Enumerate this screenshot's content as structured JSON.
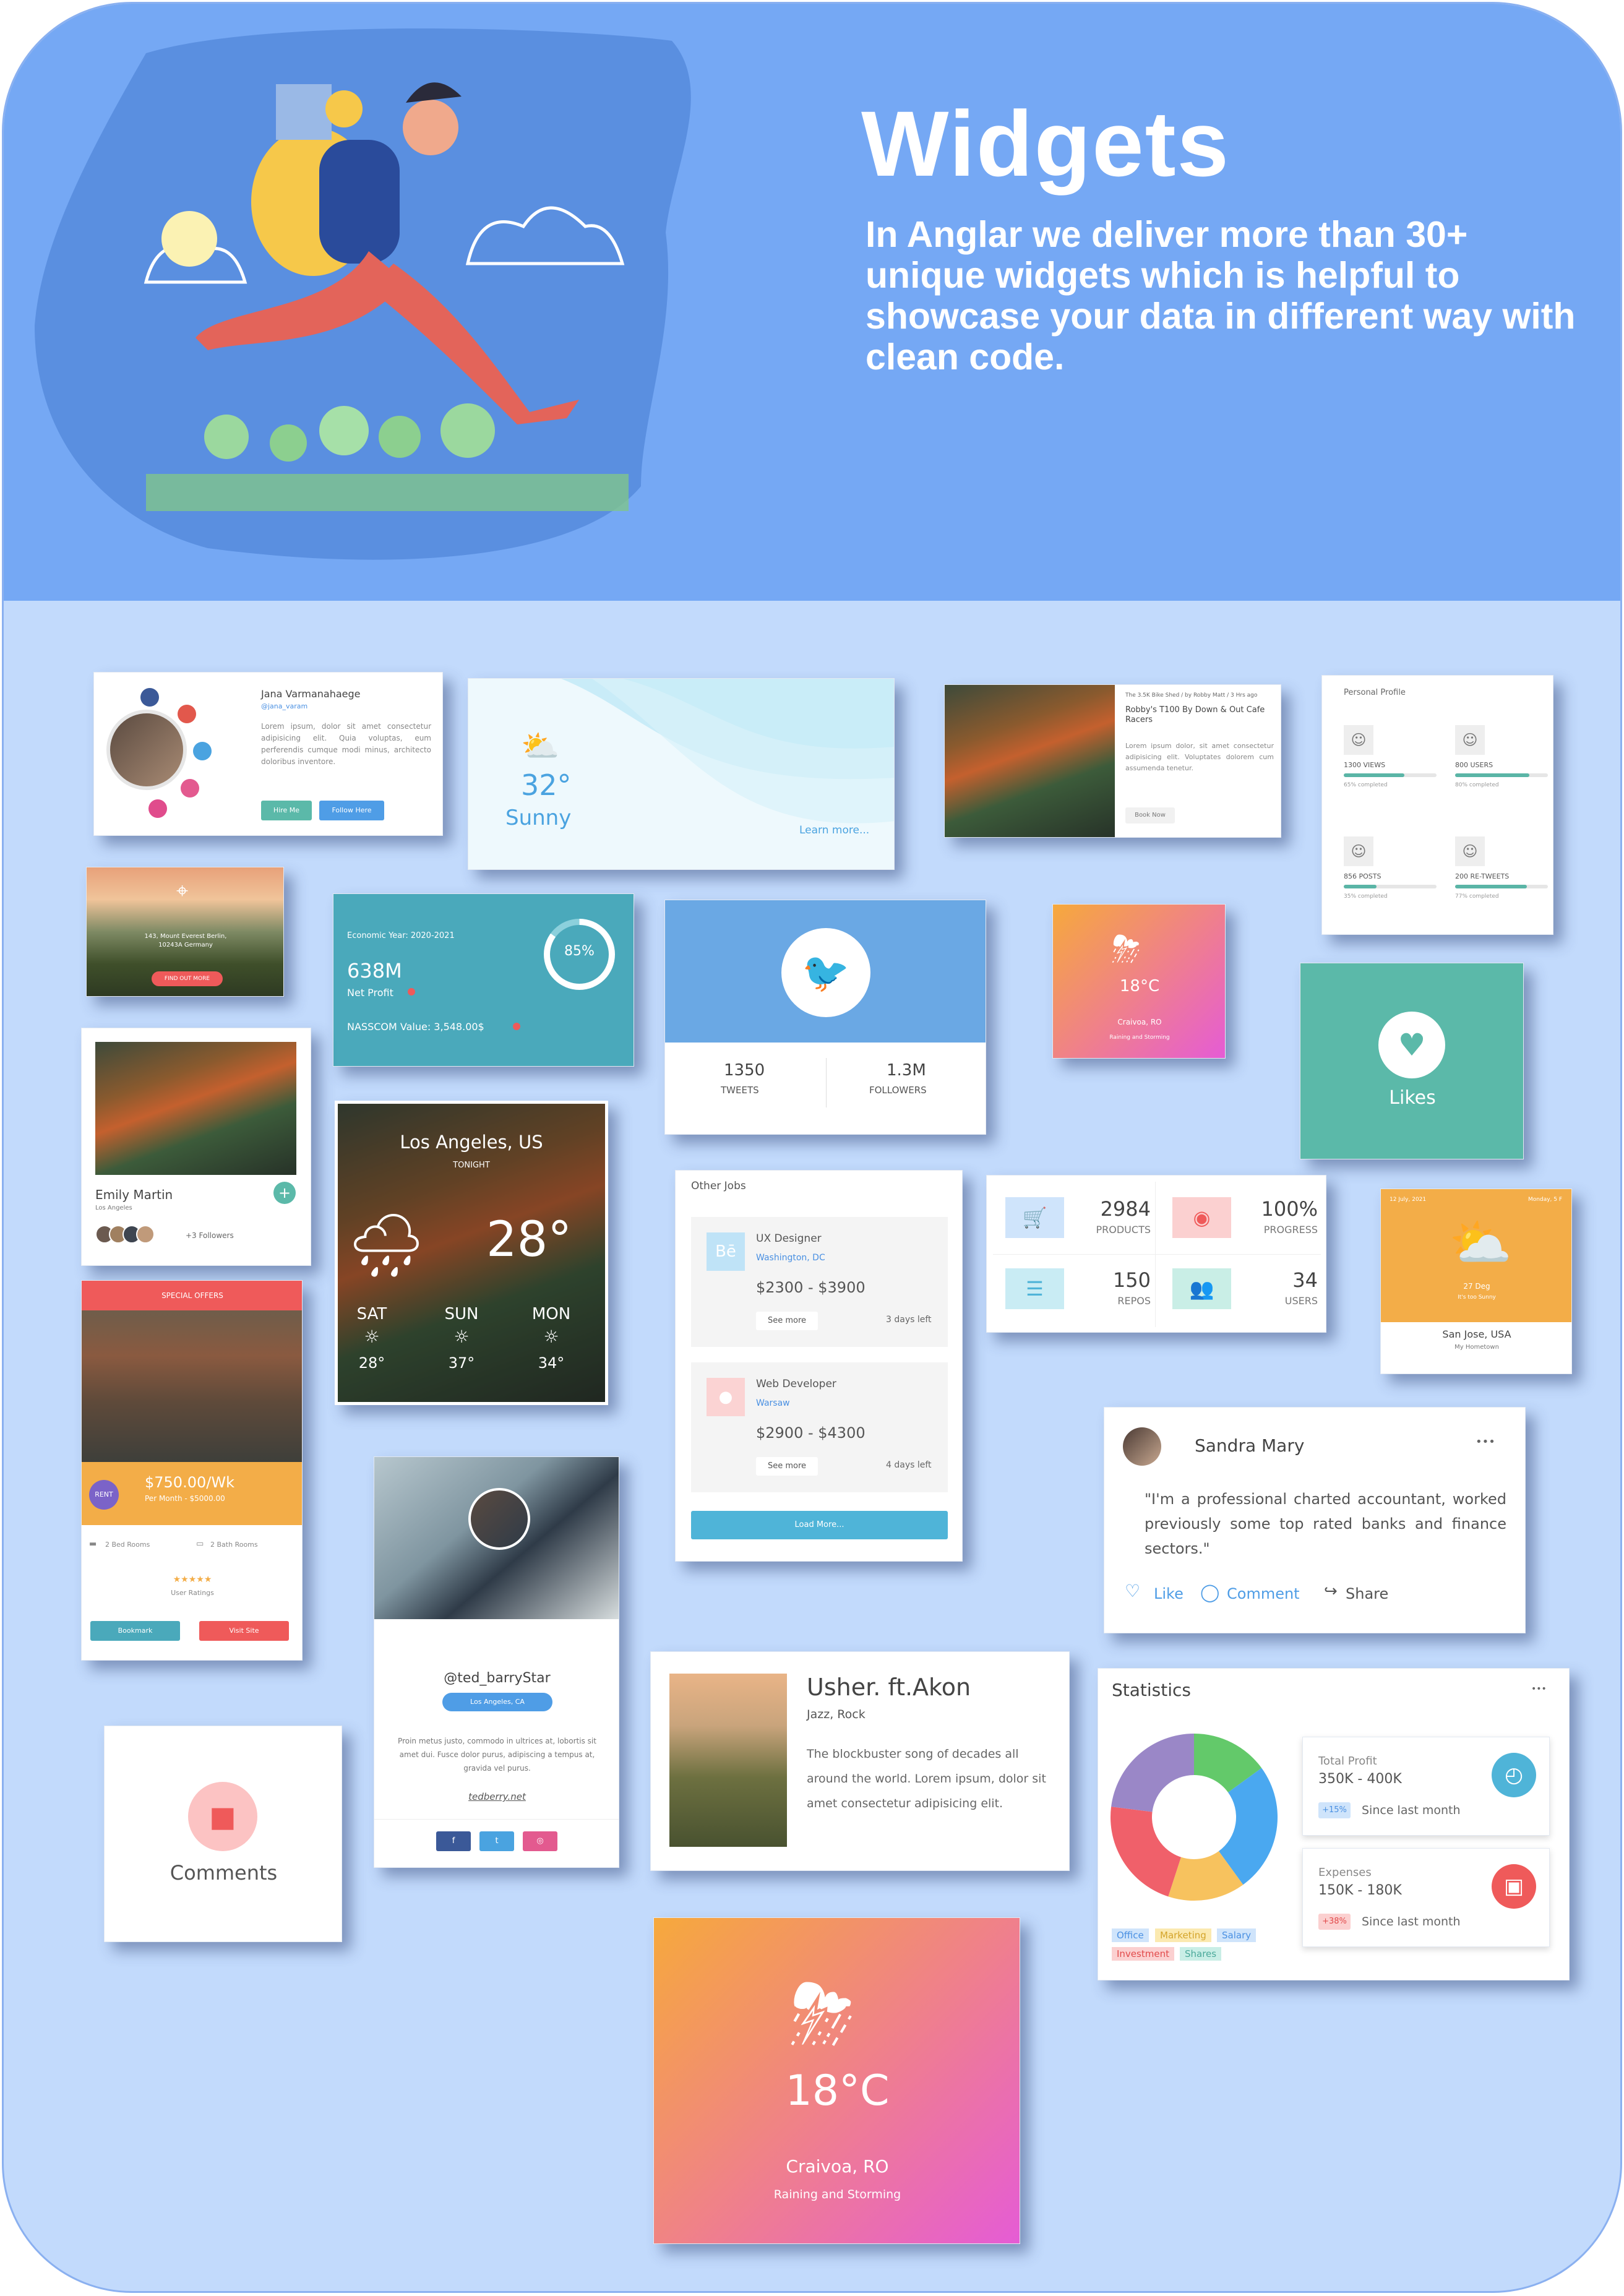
{
  "hero": {
    "title": "Widgets",
    "subtitle": "In Anglar we deliver more than 30+ unique widgets which is helpful to showcase your data in different way with clean code."
  },
  "profile": {
    "name": "Jana Varmanahaege",
    "handle": "@jana_varam",
    "bio": "Lorem ipsum, dolor sit amet consectetur adipisicing elit. Quia voluptas, eum perferendis cumque modi minus, architecto doloribus inventore.",
    "hire": "Hire Me",
    "follow": "Follow Here"
  },
  "weather_sunny": {
    "temp": "32°",
    "cond": "Sunny",
    "link": "Learn more..."
  },
  "blog": {
    "meta": "The 3.5K Bike Shed / by Robby Matt / 3 Hrs ago",
    "title": "Robby's T100 By Down & Out Cafe Racers",
    "body": "Lorem ipsum dolor, sit amet consectetur adipisicing elit. Voluptates dolorem cum assumenda tenetur.",
    "button": "Book Now"
  },
  "personal": {
    "title": "Personal Profile",
    "stats": [
      {
        "label": "1300 VIEWS",
        "sub": "65% completed",
        "pct": 0.65
      },
      {
        "label": "800 USERS",
        "sub": "80% completed",
        "pct": 0.8
      },
      {
        "label": "856 POSTS",
        "sub": "35% completed",
        "pct": 0.35
      },
      {
        "label": "200 RE-TWEETS",
        "sub": "77% completed",
        "pct": 0.77
      }
    ]
  },
  "location": {
    "address": "143, Mount Everest Berlin, 10243A Germany",
    "button": "FIND OUT MORE"
  },
  "economy": {
    "year": "Economic Year: 2020-2021",
    "value": "638M",
    "label": "Net Profit",
    "pct": "85%",
    "nasscom": "NASSCOM Value: 3,548.00$"
  },
  "twitter": {
    "tweets": "1350",
    "tweets_label": "TWEETS",
    "followers": "1.3M",
    "followers_label": "FOLLOWERS"
  },
  "weather_small": {
    "temp": "18°C",
    "city": "Craivoa, RO",
    "cond": "Raining and Storming"
  },
  "likes": {
    "label": "Likes"
  },
  "emily": {
    "name": "Emily Martin",
    "city": "Los Angeles",
    "followers": "+3 Followers"
  },
  "la": {
    "city": "Los Angeles, US",
    "tonight": "TONIGHT",
    "temp": "28°",
    "days": [
      {
        "d": "SAT",
        "t": "28°"
      },
      {
        "d": "SUN",
        "t": "37°"
      },
      {
        "d": "MON",
        "t": "34°"
      }
    ]
  },
  "jobs": {
    "title": "Other Jobs",
    "items": [
      {
        "logo": "Bē",
        "role": "UX Designer",
        "city": "Washington, DC",
        "range": "$2300 - $3900",
        "more": "See more",
        "left": "3 days left"
      },
      {
        "logo": "●",
        "role": "Web Developer",
        "city": "Warsaw",
        "range": "$2900 - $4300",
        "more": "See more",
        "left": "4 days left"
      }
    ],
    "load": "Load More..."
  },
  "stats4": [
    {
      "v": "2984",
      "l": "PRODUCTS"
    },
    {
      "v": "100%",
      "l": "PROGRESS"
    },
    {
      "v": "150",
      "l": "REPOS"
    },
    {
      "v": "34",
      "l": "USERS"
    }
  ],
  "sanjose": {
    "date": "12 July, 2021",
    "day": "Monday, 5 F",
    "temp": "27 Deg",
    "sub": "It's too Sunny",
    "city": "San Jose, USA",
    "home": "My Hometown"
  },
  "offer": {
    "header": "SPECIAL OFFERS",
    "badge": "RENT",
    "price": "$750.00/Wk",
    "sub": "Per Month - $5000.00",
    "bed": "2 Bed Rooms",
    "bath": "2 Bath Rooms",
    "stars": "★★★★★",
    "rating": "User Ratings",
    "bookmark": "Bookmark",
    "visit": "Visit Site"
  },
  "ted": {
    "handle": "@ted_barryStar",
    "city": "Los Angeles, CA",
    "bio": "Proin metus justo, commodo in ultrices at, lobortis sit amet dui. Fusce dolor purus, adipiscing a tempus at, gravida vel purus.",
    "site": "tedberry.net",
    "f": "f",
    "tw": "t",
    "ig": "◎"
  },
  "sandra": {
    "name": "Sandra Mary",
    "dots": "•••",
    "quote": "\"I'm a professional charted accountant, worked previously some top rated banks and finance sectors.\"",
    "like": "Like",
    "comment": "Comment",
    "share": "Share"
  },
  "usher": {
    "title": "Usher. ft.Akon",
    "genre": "Jazz, Rock",
    "body": "The blockbuster song of decades all around the world. Lorem ipsum, dolor sit amet consectetur adipisicing elit."
  },
  "comments": {
    "label": "Comments"
  },
  "statistics": {
    "title": "Statistics",
    "dots": "•••",
    "profit": {
      "label": "Total Profit",
      "range": "350K - 400K",
      "badge": "+15%",
      "since": "Since last month"
    },
    "expenses": {
      "label": "Expenses",
      "range": "150K - 180K",
      "badge": "+38%",
      "since": "Since last month"
    },
    "legend": [
      "Office",
      "Marketing",
      "Salary",
      "Investment",
      "Shares"
    ]
  },
  "chart_data": {
    "type": "pie",
    "categories": [
      "Office",
      "Marketing",
      "Salary",
      "Investment",
      "Shares"
    ],
    "values": [
      15,
      25,
      15,
      22,
      23
    ],
    "colors": [
      "#63c96a",
      "#4aa8f0",
      "#f7c25e",
      "#f0606a",
      "#9a87c7"
    ]
  },
  "weather_big": {
    "temp": "18°C",
    "city": "Craivoa, RO",
    "cond": "Raining and Storming"
  },
  "colors": {
    "hero": "#75a8f4",
    "body": "#c2dafc",
    "teal": "#5bb9a9",
    "twitter": "#6aa8e4",
    "orange": "#f3ad48"
  }
}
